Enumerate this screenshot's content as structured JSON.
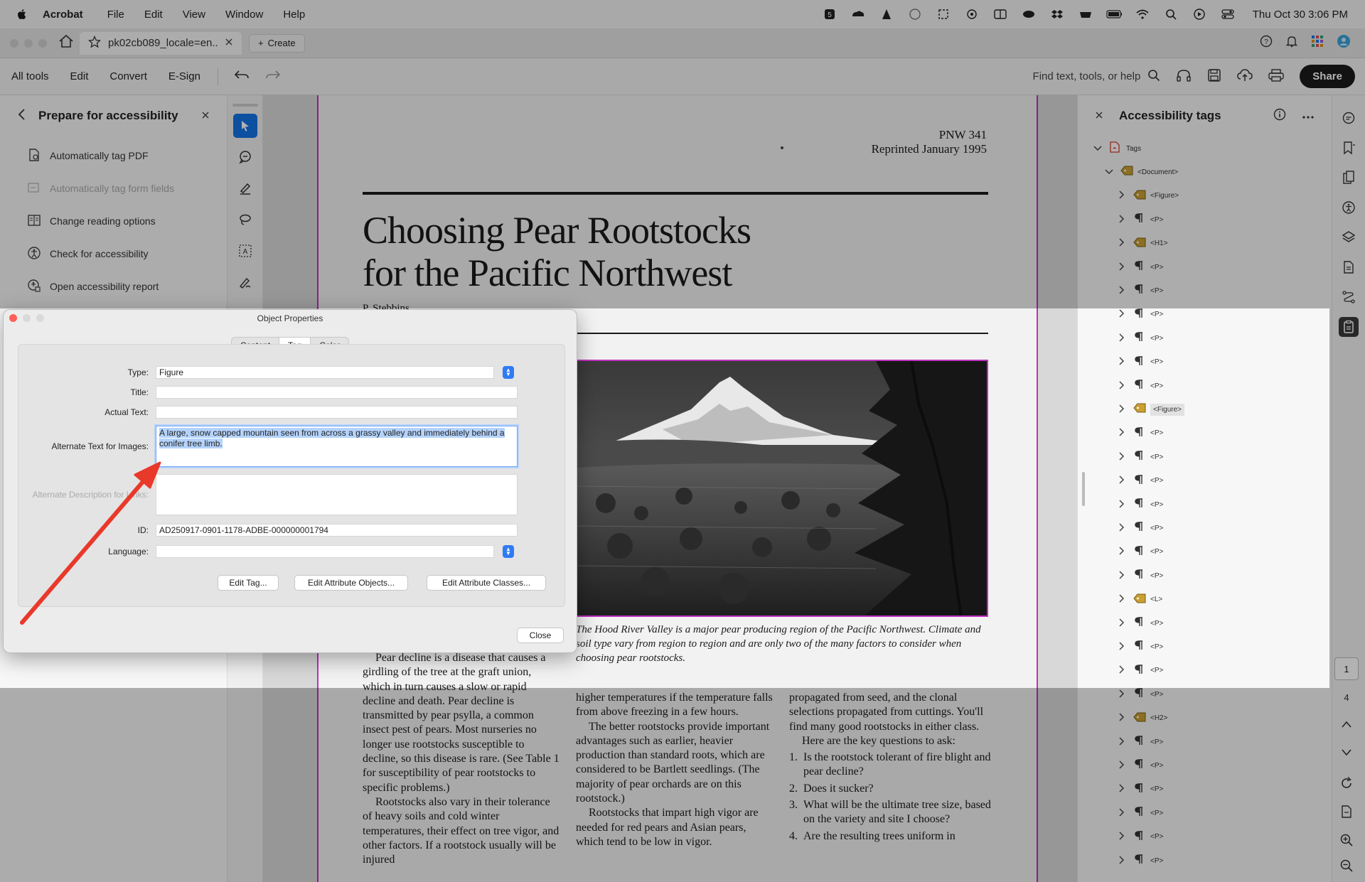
{
  "menubar": {
    "app": "Acrobat",
    "items": [
      "File",
      "Edit",
      "View",
      "Window",
      "Help"
    ],
    "clock": "Thu Oct 30  3:06 PM"
  },
  "tabs": {
    "active_tab": "pk02cb089_locale=en....",
    "create_label": "Create"
  },
  "toolbar": {
    "all_tools": "All tools",
    "edit": "Edit",
    "convert": "Convert",
    "esign": "E-Sign",
    "find_placeholder": "Find text, tools, or help",
    "share": "Share"
  },
  "left_panel": {
    "title": "Prepare for accessibility",
    "items": [
      {
        "label": "Automatically tag PDF",
        "disabled": false
      },
      {
        "label": "Automatically tag form fields",
        "disabled": true
      },
      {
        "label": "Change reading options",
        "disabled": false
      },
      {
        "label": "Check for accessibility",
        "disabled": false
      },
      {
        "label": "Open accessibility report",
        "disabled": false
      }
    ]
  },
  "document": {
    "pnw": "PNW 341",
    "reprinted": "Reprinted January 1995",
    "title_line1": "Choosing Pear Rootstocks",
    "title_line2": "for the Pacific Northwest",
    "author_partial": "P. Stebbins",
    "caption": "The Hood River Valley is a major pear producing region of the Pacific Northwest. Climate and soil type vary from region to region and are only two of the many factors to consider when choosing pear rootstocks.",
    "col1": [
      "Pear decline is a disease that causes a girdling of the tree at the graft union, which in turn causes a slow or rapid decline and death. Pear decline is transmitted by pear psylla, a common insect pest of pears. Most nurseries no longer use rootstocks susceptible to decline, so this disease is rare. (See Table 1 for susceptibility of pear rootstocks to specific problems.)",
      "Rootstocks also vary in their tolerance of heavy soils and cold winter temperatures, their effect on tree vigor, and other factors. If a rootstock usually will be injured"
    ],
    "col2": [
      "higher temperatures if the temperature falls from above freezing in a few hours.",
      "The better rootstocks provide important advantages such as earlier, heavier production than standard roots, which are considered to be Bartlett seedlings. (The majority of pear orchards are on this rootstock.)",
      "Rootstocks that impart high vigor are needed for red pears and Asian pears, which tend to be low in vigor."
    ],
    "col3_intro": "propagated from seed, and the clonal selections propagated from cuttings. You'll find many good rootstocks in either class.",
    "col3_lead": "Here are the key questions to ask:",
    "col3_list": [
      {
        "n": "1.",
        "t": "Is the rootstock tolerant of fire blight and pear decline?"
      },
      {
        "n": "2.",
        "t": "Does it sucker?"
      },
      {
        "n": "3.",
        "t": "What will be the ultimate tree size, based on the variety and site I choose?"
      },
      {
        "n": "4.",
        "t": "Are the resulting trees uniform in"
      }
    ]
  },
  "right_panel": {
    "title": "Accessibility tags",
    "tags": [
      {
        "label": "Tags",
        "level": 0,
        "icon": "pdf",
        "chev": "down"
      },
      {
        "label": "<Document>",
        "level": 1,
        "icon": "tag",
        "chev": "down"
      },
      {
        "label": "<Figure>",
        "level": 2,
        "icon": "tag",
        "chev": "right"
      },
      {
        "label": "<P>",
        "level": 2,
        "icon": "para",
        "chev": "right"
      },
      {
        "label": "<H1>",
        "level": 2,
        "icon": "tag",
        "chev": "right"
      },
      {
        "label": "<P>",
        "level": 2,
        "icon": "para",
        "chev": "right"
      },
      {
        "label": "<P>",
        "level": 2,
        "icon": "para",
        "chev": "right"
      },
      {
        "label": "<P>",
        "level": 2,
        "icon": "para",
        "chev": "right"
      },
      {
        "label": "<P>",
        "level": 2,
        "icon": "para",
        "chev": "right"
      },
      {
        "label": "<P>",
        "level": 2,
        "icon": "para",
        "chev": "right"
      },
      {
        "label": "<P>",
        "level": 2,
        "icon": "para",
        "chev": "right"
      },
      {
        "label": "<Figure>",
        "level": 2,
        "icon": "tag",
        "chev": "right",
        "selected": true
      },
      {
        "label": "<P>",
        "level": 2,
        "icon": "para",
        "chev": "right"
      },
      {
        "label": "<P>",
        "level": 2,
        "icon": "para",
        "chev": "right"
      },
      {
        "label": "<P>",
        "level": 2,
        "icon": "para",
        "chev": "right"
      },
      {
        "label": "<P>",
        "level": 2,
        "icon": "para",
        "chev": "right"
      },
      {
        "label": "<P>",
        "level": 2,
        "icon": "para",
        "chev": "right"
      },
      {
        "label": "<P>",
        "level": 2,
        "icon": "para",
        "chev": "right"
      },
      {
        "label": "<P>",
        "level": 2,
        "icon": "para",
        "chev": "right"
      },
      {
        "label": "<L>",
        "level": 2,
        "icon": "tag",
        "chev": "right"
      },
      {
        "label": "<P>",
        "level": 2,
        "icon": "para",
        "chev": "right"
      },
      {
        "label": "<P>",
        "level": 2,
        "icon": "para",
        "chev": "right"
      },
      {
        "label": "<P>",
        "level": 2,
        "icon": "para",
        "chev": "right"
      },
      {
        "label": "<P>",
        "level": 2,
        "icon": "para",
        "chev": "right"
      },
      {
        "label": "<H2>",
        "level": 2,
        "icon": "tag",
        "chev": "right"
      },
      {
        "label": "<P>",
        "level": 2,
        "icon": "para",
        "chev": "right"
      },
      {
        "label": "<P>",
        "level": 2,
        "icon": "para",
        "chev": "right"
      },
      {
        "label": "<P>",
        "level": 2,
        "icon": "para",
        "chev": "right"
      },
      {
        "label": "<P>",
        "level": 2,
        "icon": "para",
        "chev": "right"
      },
      {
        "label": "<P>",
        "level": 2,
        "icon": "para",
        "chev": "right"
      },
      {
        "label": "<P>",
        "level": 2,
        "icon": "para",
        "chev": "right"
      }
    ]
  },
  "page_nav": {
    "current": "1",
    "total": "4"
  },
  "dialog": {
    "title": "Object Properties",
    "tabs": [
      "Content",
      "Tag",
      "Color"
    ],
    "active_tab": "Tag",
    "type_label": "Type:",
    "type_value": "Figure",
    "title_label": "Title:",
    "title_value": "",
    "actual_text_label": "Actual Text:",
    "actual_text_value": "",
    "alt_text_label": "Alternate Text for Images:",
    "alt_text_value": "A large, snow capped mountain seen from across a grassy valley and immediately behind a conifer tree limb.",
    "alt_desc_label": "Alternate Description for Links:",
    "alt_desc_value": "",
    "id_label": "ID:",
    "id_value": "AD250917-0901-1178-ADBE-000000001794",
    "language_label": "Language:",
    "language_value": "",
    "edit_tag": "Edit Tag...",
    "edit_attr_objects": "Edit Attribute Objects...",
    "edit_attr_classes": "Edit Attribute Classes...",
    "close": "Close"
  },
  "colors": {
    "accent": "#1473e6",
    "highlight_border": "#c030c0",
    "annotation_arrow": "#e8392a"
  }
}
